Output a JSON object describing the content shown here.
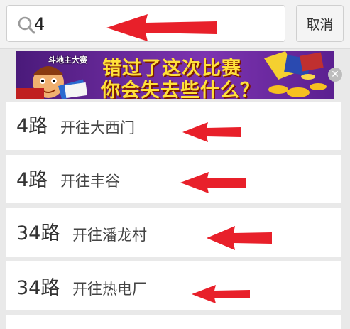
{
  "search": {
    "value": "4"
  },
  "cancel_label": "取消",
  "banner": {
    "brand": "斗地主大赛",
    "line1": "错过了这次比赛",
    "line2": "你会失去些什么？",
    "close_icon": "close-icon"
  },
  "routes": [
    {
      "number": "4路",
      "destination": "开往大西门"
    },
    {
      "number": "4路",
      "destination": "开往丰谷"
    },
    {
      "number": "34路",
      "destination": "开往潘龙村"
    },
    {
      "number": "34路",
      "destination": "开往热电厂"
    }
  ],
  "colors": {
    "arrow": "#e8202a",
    "banner_text": "#ffe23a",
    "banner_bg": "#6a2a9c"
  }
}
